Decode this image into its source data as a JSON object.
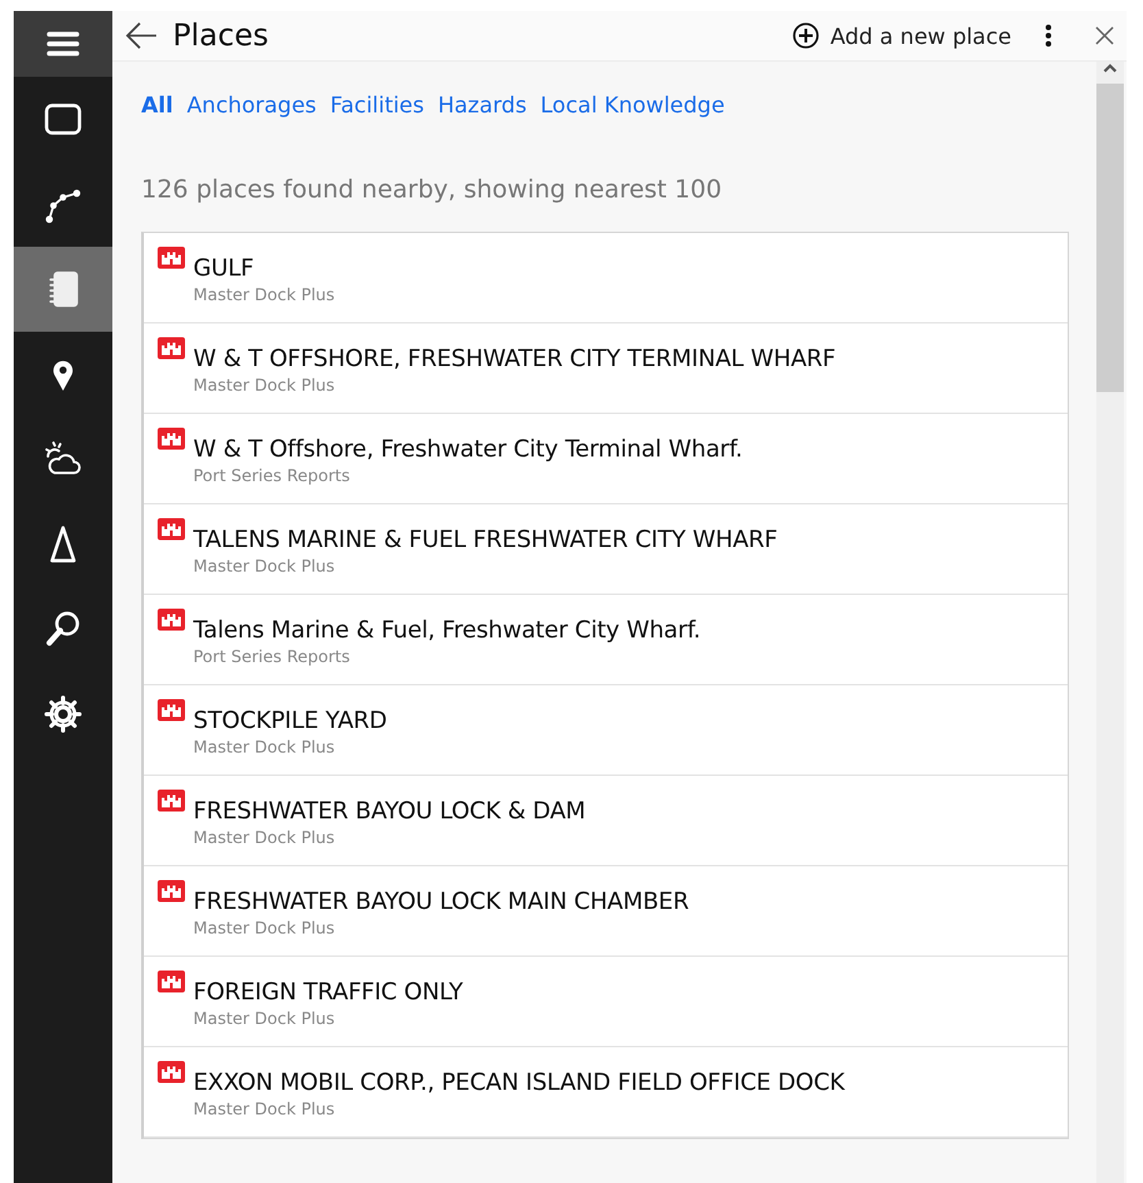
{
  "sidebar": {
    "items": [
      {
        "kind": "menu",
        "selected": false
      },
      {
        "kind": "chart",
        "selected": false
      },
      {
        "kind": "route",
        "selected": false
      },
      {
        "kind": "places",
        "selected": true
      },
      {
        "kind": "pin",
        "selected": false
      },
      {
        "kind": "weather",
        "selected": false
      },
      {
        "kind": "tides",
        "selected": false
      },
      {
        "kind": "search",
        "selected": false
      },
      {
        "kind": "settings",
        "selected": false
      }
    ]
  },
  "header": {
    "title": "Places",
    "add_button": "Add a new place"
  },
  "filters": [
    {
      "label": "All",
      "selected": true
    },
    {
      "label": "Anchorages",
      "selected": false
    },
    {
      "label": "Facilities",
      "selected": false
    },
    {
      "label": "Hazards",
      "selected": false
    },
    {
      "label": "Local Knowledge",
      "selected": false
    }
  ],
  "summary": "126 places found nearby, showing nearest 100",
  "places": [
    {
      "name": "GULF",
      "source": "Master Dock Plus"
    },
    {
      "name": "W & T OFFSHORE, FRESHWATER CITY TERMINAL WHARF",
      "source": "Master Dock Plus"
    },
    {
      "name": "W & T Offshore, Freshwater City Terminal Wharf.",
      "source": "Port Series Reports"
    },
    {
      "name": "TALENS MARINE & FUEL FRESHWATER CITY WHARF",
      "source": "Master Dock Plus"
    },
    {
      "name": "Talens Marine & Fuel, Freshwater City Wharf.",
      "source": "Port Series Reports"
    },
    {
      "name": "STOCKPILE YARD",
      "source": "Master Dock Plus"
    },
    {
      "name": "FRESHWATER BAYOU LOCK & DAM",
      "source": "Master Dock Plus"
    },
    {
      "name": "FRESHWATER BAYOU LOCK MAIN CHAMBER",
      "source": "Master Dock Plus"
    },
    {
      "name": "FOREIGN TRAFFIC ONLY",
      "source": "Master Dock Plus"
    },
    {
      "name": "EXXON MOBIL CORP., PECAN ISLAND FIELD OFFICE DOCK",
      "source": "Master Dock Plus"
    }
  ]
}
